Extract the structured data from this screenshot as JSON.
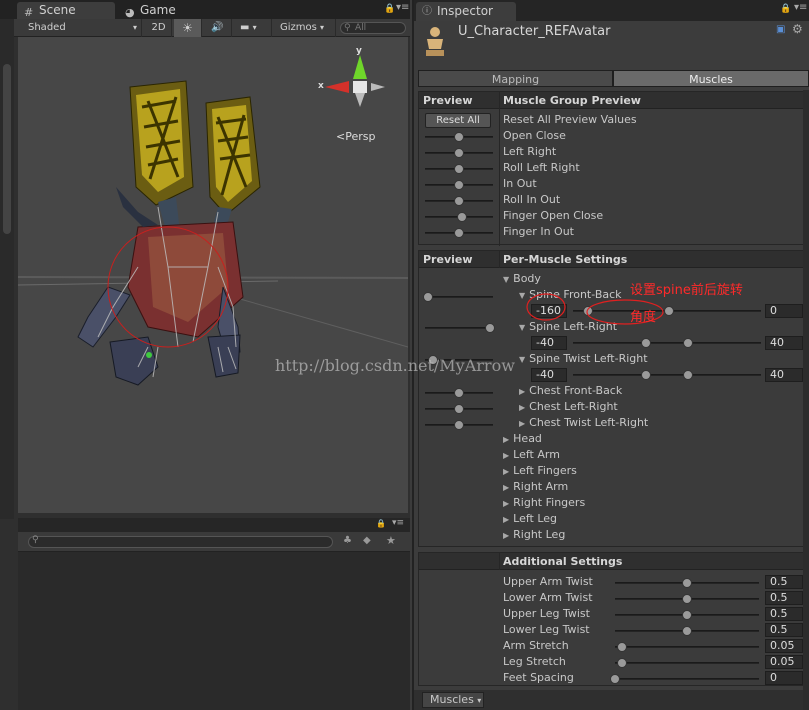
{
  "scene_tabs": {
    "scene": "Scene",
    "game": "Game"
  },
  "scene_toolbar": {
    "shading": "Shaded",
    "mode2d": "2D",
    "gizmos": "Gizmos",
    "search_placeholder": "All"
  },
  "gizmo": {
    "x": "x",
    "y": "y",
    "persp": "Persp"
  },
  "watermark": "http://blog.csdn.net/MyArrow",
  "annotation": {
    "text_line1": "设置spine前后旋转",
    "text_line2": "角度"
  },
  "inspector": {
    "tab": "Inspector",
    "asset_name": "U_Character_REFAvatar",
    "mode_tabs": [
      "Mapping",
      "Muscles"
    ],
    "active_mode": "Muscles",
    "group_preview": {
      "preview_header": "Preview",
      "header": "Muscle Group Preview",
      "reset_button": "Reset All",
      "reset_all_label": "Reset All Preview Values",
      "items": [
        {
          "label": "Open Close",
          "level": 0.5
        },
        {
          "label": "Left Right",
          "level": 0.5
        },
        {
          "label": "Roll Left Right",
          "level": 0.5
        },
        {
          "label": "In Out",
          "level": 0.5
        },
        {
          "label": "Roll In Out",
          "level": 0.5
        },
        {
          "label": "Finger Open Close",
          "level": 0.55
        },
        {
          "label": "Finger In Out",
          "level": 0.5
        }
      ]
    },
    "per_muscle": {
      "preview_header": "Preview",
      "header": "Per-Muscle Settings",
      "body_label": "Body",
      "spine_front_back": {
        "label": "Spine Front-Back",
        "min": "-160",
        "max": "0"
      },
      "spine_left_right": {
        "label": "Spine Left-Right",
        "min": "-40",
        "max": "40"
      },
      "spine_twist": {
        "label": "Spine Twist Left-Right",
        "min": "-40",
        "max": "40"
      },
      "collapsed_items": [
        "Chest Front-Back",
        "Chest Left-Right",
        "Chest Twist Left-Right"
      ],
      "groups": [
        "Head",
        "Left Arm",
        "Left Fingers",
        "Right Arm",
        "Right Fingers",
        "Left Leg",
        "Right Leg"
      ]
    },
    "additional": {
      "header": "Additional Settings",
      "items": [
        {
          "label": "Upper Arm Twist",
          "value": "0.5",
          "level": 0.5
        },
        {
          "label": "Lower Arm Twist",
          "value": "0.5",
          "level": 0.5
        },
        {
          "label": "Upper Leg Twist",
          "value": "0.5",
          "level": 0.5
        },
        {
          "label": "Lower Leg Twist",
          "value": "0.5",
          "level": 0.5
        },
        {
          "label": "Arm Stretch",
          "value": "0.05",
          "level": 0.05
        },
        {
          "label": "Leg Stretch",
          "value": "0.05",
          "level": 0.05
        },
        {
          "label": "Feet Spacing",
          "value": "0",
          "level": 0
        }
      ]
    },
    "status_dropdown": "Muscles"
  }
}
